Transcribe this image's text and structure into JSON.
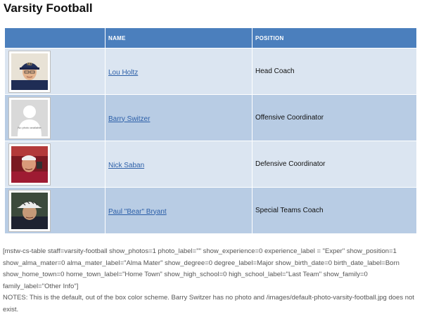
{
  "page": {
    "title": "Varsity Football"
  },
  "table": {
    "headers": {
      "photo": "",
      "name": "NAME",
      "position": "POSITION"
    },
    "rows": [
      {
        "name": "Lou Holtz",
        "position": "Head Coach",
        "photo": "coach-photo"
      },
      {
        "name": "Barry Switzer",
        "position": "Offensive Coordinator",
        "photo": "no-photo-placeholder",
        "photo_caption": "No photo available"
      },
      {
        "name": "Nick Saban",
        "position": "Defensive Coordinator",
        "photo": "coach-photo"
      },
      {
        "name": "Paul \"Bear\" Bryant",
        "position": "Special Teams Coach",
        "photo": "coach-photo"
      }
    ]
  },
  "notes": {
    "shortcode": "[mstw-cs-table staff=varsity-football show_photos=1 photo_label=\"\" show_experience=0 experience_label = \"Exper\" show_position=1 show_alma_mater=0 alma_mater_label=\"Alma Mater\" show_degree=0 degree_label=Major show_birth_date=0 birth_date_label=Born show_home_town=0 home_town_label=\"Home Town\" show_high_school=0 high_school_label=\"Last Team\" show_family=0 family_label=\"Other Info\"]",
    "text": "NOTES: This is the default, out of the box color scheme. Barry Switzer has no photo and /images/default-photo-varsity-football.jpg does not exist."
  },
  "colors": {
    "header_bg": "#4b7fbd",
    "row_light": "#dbe5f1",
    "row_dark": "#b8cce4",
    "link": "#2c5fa8"
  }
}
